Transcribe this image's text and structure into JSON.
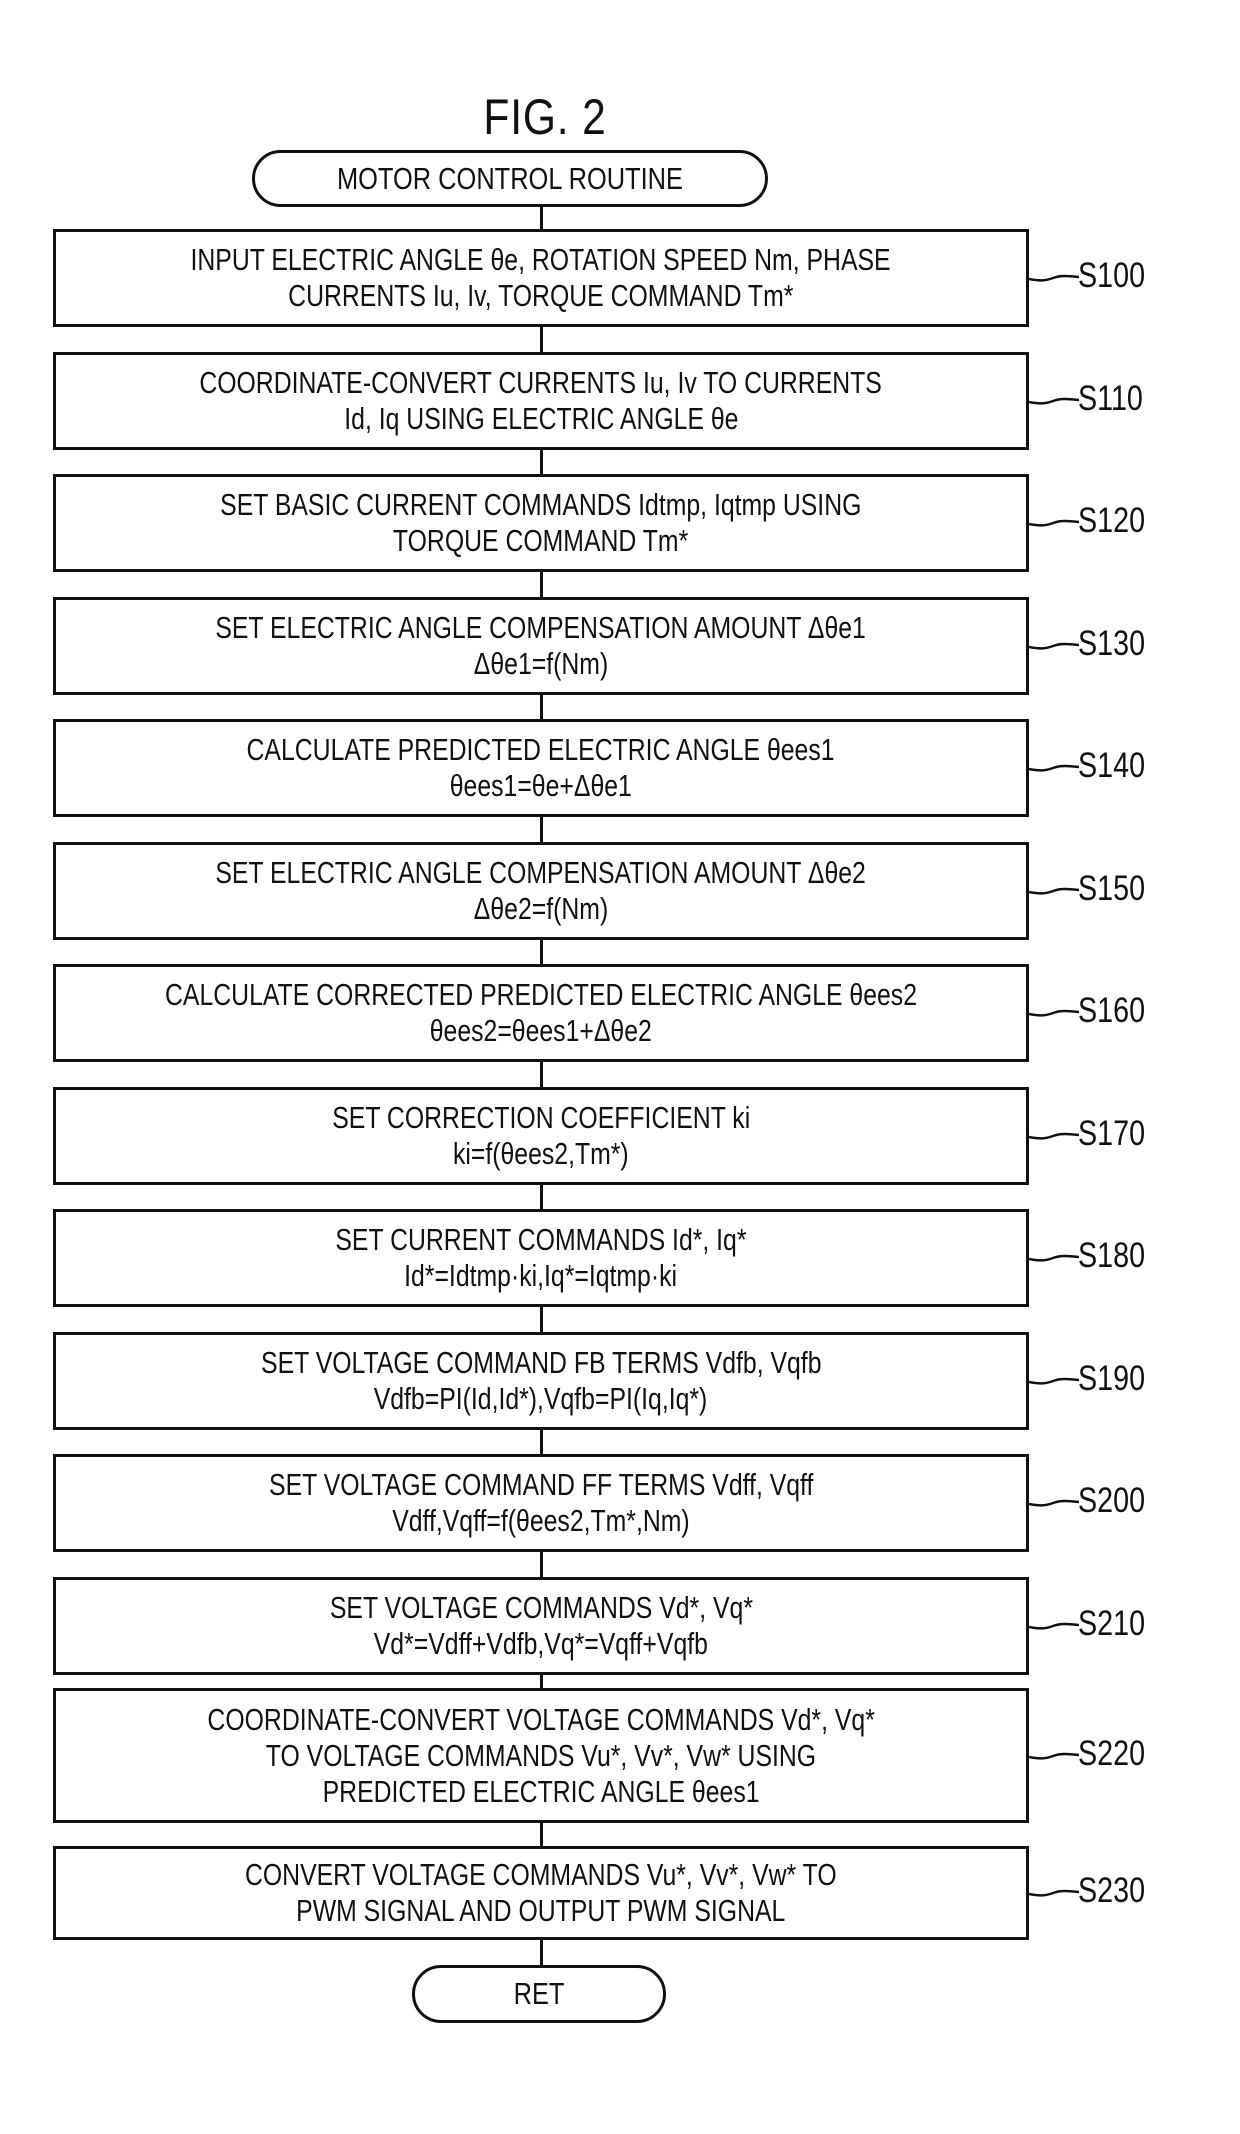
{
  "figure": {
    "title": "FIG. 2",
    "start_label": "MOTOR CONTROL ROUTINE",
    "end_label": "RET"
  },
  "steps": [
    {
      "id": "S100",
      "lines": [
        "INPUT ELECTRIC ANGLE θe, ROTATION SPEED Nm, PHASE",
        "CURRENTS Iu, Iv, TORQUE COMMAND Tm*"
      ]
    },
    {
      "id": "S110",
      "lines": [
        "COORDINATE-CONVERT CURRENTS Iu, Iv TO CURRENTS",
        "Id, Iq USING ELECTRIC ANGLE θe"
      ]
    },
    {
      "id": "S120",
      "lines": [
        "SET BASIC CURRENT COMMANDS Idtmp, Iqtmp USING",
        "TORQUE COMMAND Tm*"
      ]
    },
    {
      "id": "S130",
      "lines": [
        "SET ELECTRIC ANGLE COMPENSATION AMOUNT Δθe1",
        "Δθe1=f(Nm)"
      ]
    },
    {
      "id": "S140",
      "lines": [
        "CALCULATE PREDICTED ELECTRIC ANGLE θees1",
        "θees1=θe+Δθe1"
      ]
    },
    {
      "id": "S150",
      "lines": [
        "SET ELECTRIC ANGLE COMPENSATION AMOUNT Δθe2",
        "Δθe2=f(Nm)"
      ]
    },
    {
      "id": "S160",
      "lines": [
        "CALCULATE CORRECTED PREDICTED ELECTRIC ANGLE θees2",
        "θees2=θees1+Δθe2"
      ]
    },
    {
      "id": "S170",
      "lines": [
        "SET CORRECTION COEFFICIENT ki",
        "ki=f(θees2,Tm*)"
      ]
    },
    {
      "id": "S180",
      "lines": [
        "SET CURRENT COMMANDS Id*, Iq*",
        "Id*=Idtmp·ki,Iq*=Iqtmp·ki"
      ]
    },
    {
      "id": "S190",
      "lines": [
        "SET VOLTAGE COMMAND FB TERMS Vdfb, Vqfb",
        "Vdfb=PI(Id,Id*),Vqfb=PI(Iq,Iq*)"
      ]
    },
    {
      "id": "S200",
      "lines": [
        "SET VOLTAGE COMMAND FF TERMS Vdff, Vqff",
        "Vdff,Vqff=f(θees2,Tm*,Nm)"
      ]
    },
    {
      "id": "S210",
      "lines": [
        "SET VOLTAGE COMMANDS Vd*, Vq*",
        "Vd*=Vdff+Vdfb,Vq*=Vqff+Vqfb"
      ]
    },
    {
      "id": "S220",
      "lines": [
        "COORDINATE-CONVERT VOLTAGE COMMANDS Vd*, Vq*",
        "TO VOLTAGE COMMANDS Vu*, Vv*, Vw* USING",
        "PREDICTED ELECTRIC ANGLE θees1"
      ]
    },
    {
      "id": "S230",
      "lines": [
        "CONVERT VOLTAGE COMMANDS Vu*, Vv*, Vw* TO",
        "PWM SIGNAL AND OUTPUT PWM SIGNAL"
      ]
    }
  ]
}
